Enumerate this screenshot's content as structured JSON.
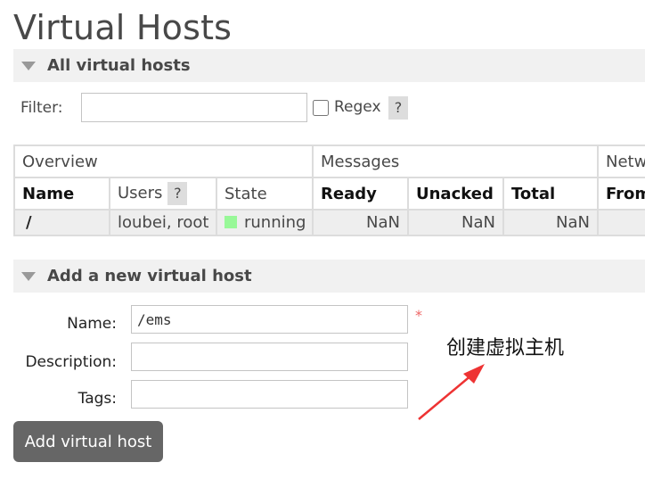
{
  "page": {
    "title": "Virtual Hosts"
  },
  "all_section": {
    "title": "All virtual hosts"
  },
  "filter": {
    "label": "Filter:",
    "value": "",
    "placeholder": "",
    "regex_label": "Regex",
    "regex_checked": false,
    "help": "?"
  },
  "table": {
    "groups": [
      "Overview",
      "Messages",
      "Netw"
    ],
    "columns": {
      "name": "Name",
      "users": "Users",
      "users_help": "?",
      "state": "State",
      "ready": "Ready",
      "unacked": "Unacked",
      "total": "Total",
      "from": "From"
    },
    "rows": [
      {
        "name": "/",
        "users": "loubei, root",
        "state": "running",
        "ready": "NaN",
        "unacked": "NaN",
        "total": "NaN",
        "from": ""
      }
    ]
  },
  "add_section": {
    "title": "Add a new virtual host",
    "name_label": "Name:",
    "name_value": "/ems",
    "required_mark": "*",
    "description_label": "Description:",
    "description_value": "",
    "tags_label": "Tags:",
    "tags_value": "",
    "submit_label": "Add virtual host"
  },
  "annotation": {
    "text": "创建虚拟主机",
    "color": "#ee3333"
  },
  "colors": {
    "header_bg": "#f1f1f1",
    "button_bg": "#666666",
    "running": "#98f898",
    "row_bg": "#eeeeee"
  }
}
